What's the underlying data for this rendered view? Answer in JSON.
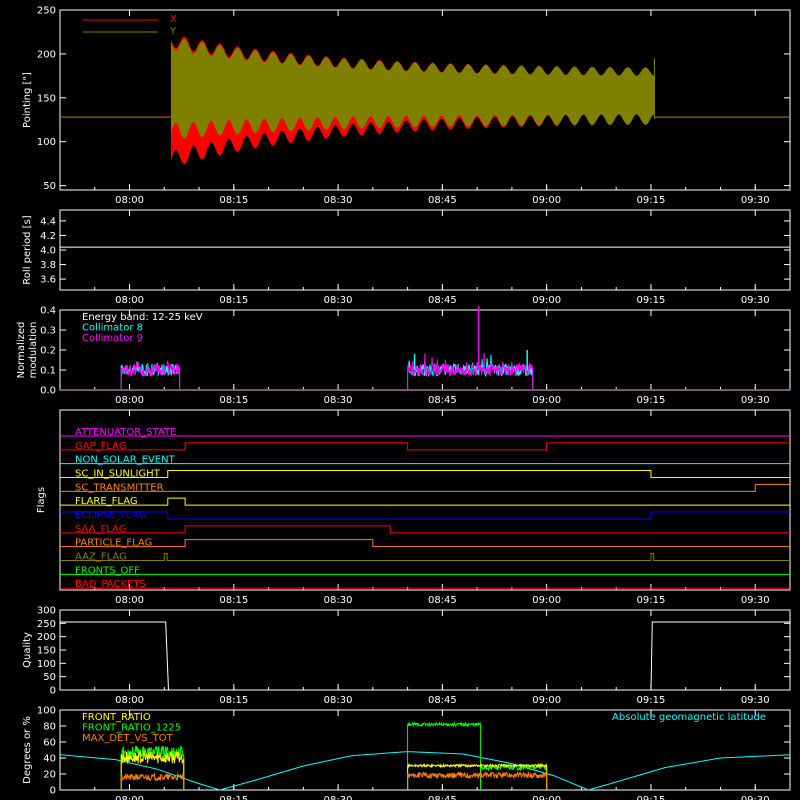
{
  "time_axis": {
    "range_minutes": [
      470,
      575
    ],
    "ticks": [
      {
        "t": 480,
        "label": "08:00"
      },
      {
        "t": 495,
        "label": "08:15"
      },
      {
        "t": 510,
        "label": "08:30"
      },
      {
        "t": 525,
        "label": "08:45"
      },
      {
        "t": 540,
        "label": "09:00"
      },
      {
        "t": 555,
        "label": "09:15"
      },
      {
        "t": 570,
        "label": "09:30"
      }
    ]
  },
  "chart_data": [
    {
      "type": "area",
      "ylabel": "Pointing [\"]",
      "ylim": [
        45,
        250
      ],
      "yticks": [
        {
          "v": 50,
          "label": "50"
        },
        {
          "v": 100,
          "label": "100"
        },
        {
          "v": 150,
          "label": "150"
        },
        {
          "v": 200,
          "label": "200"
        },
        {
          "v": 250,
          "label": "250"
        }
      ],
      "legend_position": "top-left",
      "series": [
        {
          "name": "X",
          "color": "#ff0000",
          "baseline": 128,
          "active_range": [
            486,
            555.5
          ],
          "start_range": [
            80,
            215
          ],
          "end_range": [
            128,
            178
          ]
        },
        {
          "name": "Y",
          "color": "#808000",
          "baseline": 128,
          "active_range": [
            486,
            555.5
          ],
          "start_range": [
            112,
            212
          ],
          "end_range": [
            126,
            178
          ]
        }
      ]
    },
    {
      "type": "line",
      "ylabel": "Roll period [s]",
      "ylim": [
        3.45,
        4.55
      ],
      "yticks": [
        {
          "v": 3.6,
          "label": "3.6"
        },
        {
          "v": 3.8,
          "label": "3.8"
        },
        {
          "v": 4.0,
          "label": "4.0"
        },
        {
          "v": 4.2,
          "label": "4.2"
        },
        {
          "v": 4.4,
          "label": "4.4"
        }
      ],
      "series": [
        {
          "name": "",
          "color": "#ffffff",
          "value": 4.04
        }
      ]
    },
    {
      "type": "line",
      "ylabel": [
        "Normalized",
        "modulation"
      ],
      "ylim": [
        0,
        0.4
      ],
      "yticks": [
        {
          "v": 0.0,
          "label": "0.0"
        },
        {
          "v": 0.1,
          "label": "0.1"
        },
        {
          "v": 0.2,
          "label": "0.2"
        },
        {
          "v": 0.3,
          "label": "0.3"
        },
        {
          "v": 0.4,
          "label": "0.4"
        }
      ],
      "legend": [
        {
          "label": "Energy band: 12-25 keV",
          "color": "#ffffff"
        },
        {
          "label": "Collimator 8",
          "color": "#00ffff"
        },
        {
          "label": "Collimator 9",
          "color": "#ff00ff"
        }
      ],
      "segments": [
        {
          "start": 478.8,
          "end": 487.2,
          "level": 0.1
        },
        {
          "start": 520.0,
          "end": 538.0,
          "level": 0.1
        }
      ],
      "spikes": [
        {
          "t": 530.2,
          "v": 0.42,
          "color": "#ff00ff"
        },
        {
          "t": 521.0,
          "v": 0.18,
          "color": "#00ffff"
        },
        {
          "t": 537.2,
          "v": 0.2,
          "color": "#00ffff"
        }
      ]
    },
    {
      "type": "step",
      "ylabel": "Flags",
      "flags": [
        {
          "label": "ATTENUATOR_STATE",
          "color": "#ff00ff",
          "transitions": [
            [
              470,
              0
            ]
          ]
        },
        {
          "label": "GAP_FLAG",
          "color": "#ff0000",
          "transitions": [
            [
              470,
              0
            ],
            [
              488,
              1
            ],
            [
              520,
              0
            ],
            [
              540,
              1
            ]
          ]
        },
        {
          "label": "NON_SOLAR_EVENT",
          "color": "#00ffff",
          "transitions": [
            [
              470,
              0
            ]
          ]
        },
        {
          "label": "SC_IN_SUNLIGHT",
          "color": "#ffff00",
          "transitions": [
            [
              470,
              0
            ],
            [
              485.5,
              1
            ],
            [
              555,
              0
            ]
          ]
        },
        {
          "label": "SC_TRANSMITTER",
          "color": "#ff8000",
          "transitions": [
            [
              470,
              0
            ],
            [
              570,
              1
            ]
          ]
        },
        {
          "label": "FLARE_FLAG",
          "color": "#ffff00",
          "transitions": [
            [
              470,
              0
            ],
            [
              485.5,
              1
            ],
            [
              488,
              0
            ]
          ]
        },
        {
          "label": "ECLIPSE_FLAG",
          "color": "#0000ff",
          "transitions": [
            [
              470,
              1
            ],
            [
              485.5,
              0
            ],
            [
              555,
              1
            ]
          ]
        },
        {
          "label": "SAA_FLAG",
          "color": "#ff0000",
          "transitions": [
            [
              470,
              0
            ],
            [
              488,
              1
            ],
            [
              517.5,
              0
            ]
          ]
        },
        {
          "label": "PARTICLE_FLAG",
          "color": "#ff8000",
          "transitions": [
            [
              470,
              0
            ],
            [
              488,
              1
            ],
            [
              515,
              0
            ]
          ]
        },
        {
          "label": "AAZ_FLAG",
          "color": "#808000",
          "transitions": [
            [
              470,
              0
            ],
            [
              485,
              1
            ],
            [
              485.4,
              0
            ],
            [
              555,
              1
            ],
            [
              555.4,
              0
            ]
          ]
        },
        {
          "label": "FRONTS_OFF",
          "color": "#00ff00",
          "transitions": [
            [
              470,
              0
            ]
          ]
        },
        {
          "label": "BAD_PACKETS",
          "color": "#ff0000",
          "transitions": [
            [
              470,
              0
            ]
          ]
        }
      ]
    },
    {
      "type": "line",
      "ylabel": "Quality",
      "ylim": [
        0,
        300
      ],
      "yticks": [
        {
          "v": 0,
          "label": "0"
        },
        {
          "v": 50,
          "label": "50"
        },
        {
          "v": 100,
          "label": "100"
        },
        {
          "v": 150,
          "label": "150"
        },
        {
          "v": 200,
          "label": "200"
        },
        {
          "v": 250,
          "label": "250"
        },
        {
          "v": 300,
          "label": "300"
        }
      ],
      "series": [
        {
          "name": "",
          "color": "#ffffff",
          "points": [
            [
              470,
              255
            ],
            [
              485.2,
              255
            ],
            [
              485.6,
              0
            ],
            [
              555,
              0
            ],
            [
              555.2,
              255
            ],
            [
              575,
              255
            ]
          ]
        }
      ]
    },
    {
      "type": "line",
      "ylabel": "Degrees or %",
      "ylim": [
        0,
        100
      ],
      "yticks": [
        {
          "v": 0,
          "label": "0"
        },
        {
          "v": 20,
          "label": "20"
        },
        {
          "v": 40,
          "label": "40"
        },
        {
          "v": 60,
          "label": "60"
        },
        {
          "v": 80,
          "label": "80"
        },
        {
          "v": 100,
          "label": "100"
        }
      ],
      "legend": [
        {
          "label": "FRONT_RATIO",
          "color": "#ffff00"
        },
        {
          "label": "FRONT_RATIO_1225",
          "color": "#00ff00"
        },
        {
          "label": "MAX_DET_VS_TOT",
          "color": "#ff8000"
        }
      ],
      "latitude_label": "Absolute geomagnetic latitude",
      "latitude_color": "#00ffff",
      "latitude_curve": [
        [
          470,
          44
        ],
        [
          478,
          38
        ],
        [
          484,
          26
        ],
        [
          490,
          8
        ],
        [
          493,
          0
        ],
        [
          498,
          12
        ],
        [
          505,
          30
        ],
        [
          512,
          43
        ],
        [
          520,
          48
        ],
        [
          528,
          45
        ],
        [
          535,
          33
        ],
        [
          541,
          18
        ],
        [
          546,
          0
        ],
        [
          550,
          10
        ],
        [
          557,
          28
        ],
        [
          565,
          40
        ],
        [
          575,
          44
        ]
      ],
      "segments": [
        {
          "start": 478.8,
          "end": 487.8,
          "front": [
            33,
            48
          ],
          "front1225": [
            40,
            55
          ],
          "maxdet": [
            12,
            20
          ]
        },
        {
          "start": 520.0,
          "end": 540.0,
          "front": [
            29,
            32
          ],
          "front1225_first": [
            80,
            84
          ],
          "front1225_split": 530.5,
          "front1225": [
            25,
            32
          ],
          "maxdet": [
            15,
            22
          ]
        }
      ]
    }
  ]
}
